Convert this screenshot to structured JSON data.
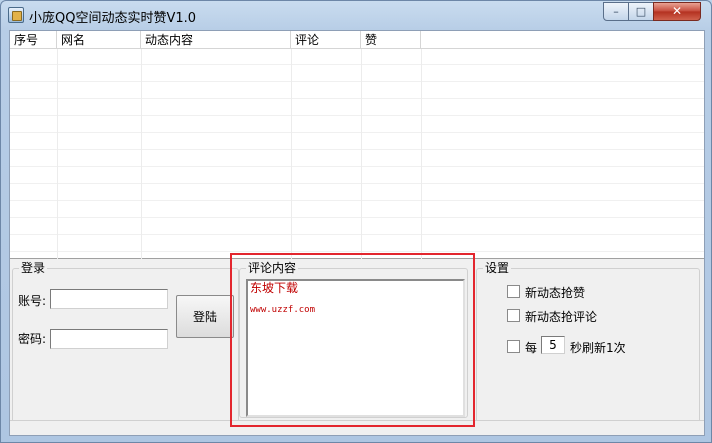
{
  "window": {
    "title": "小庞QQ空间动态实时赞V1.0",
    "controls": {
      "minimize": "–",
      "maximize": "□",
      "close": "✕"
    }
  },
  "list": {
    "columns": [
      "序号",
      "网名",
      "动态内容",
      "评论",
      "赞"
    ]
  },
  "login": {
    "group_title": "登录",
    "account_label": "账号:",
    "account_value": "",
    "password_label": "密码:",
    "password_value": "",
    "login_button": "登陆"
  },
  "comment": {
    "group_title": "评论内容",
    "line1": "东坡下载",
    "line2": "www.uzzf.com"
  },
  "settings": {
    "group_title": "设置",
    "auto_like_label": "新动态抢赞",
    "auto_like_checked": false,
    "auto_comment_label": "新动态抢评论",
    "auto_comment_checked": false,
    "refresh_prefix": "每",
    "refresh_interval": "5",
    "refresh_suffix": "秒刷新1次",
    "refresh_checked": false
  },
  "colors": {
    "highlight": "#e3262e",
    "comment_text": "#c00000"
  }
}
